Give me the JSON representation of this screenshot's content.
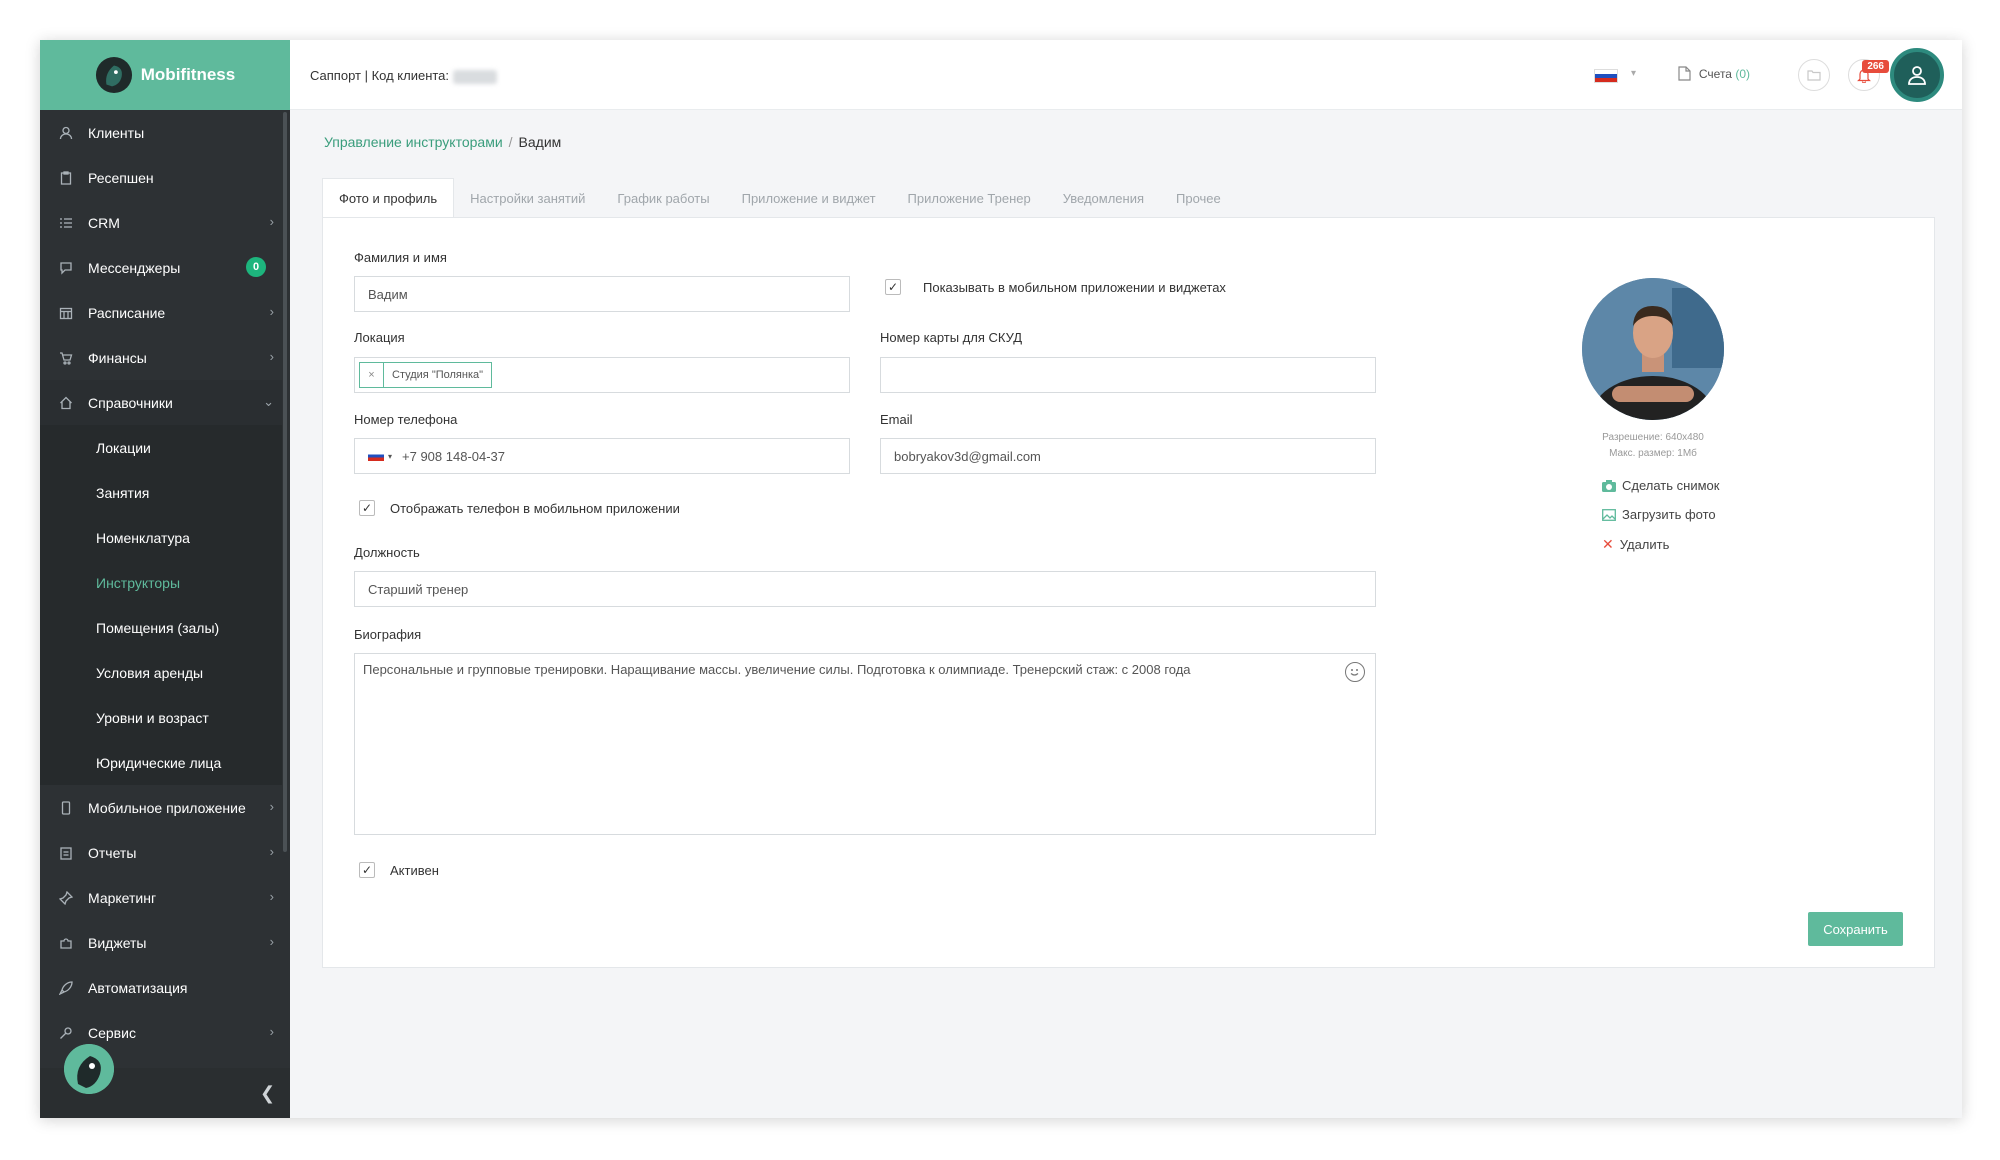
{
  "app": {
    "name": "Mobifitness"
  },
  "topbar": {
    "support_label": "Саппорт | Код клиента:",
    "invoices_label": "Счета",
    "invoices_count": "(0)",
    "notifications_count": "266"
  },
  "sidebar": {
    "items": [
      {
        "label": "Клиенты",
        "icon": "user-icon"
      },
      {
        "label": "Ресепшен",
        "icon": "clipboard-icon"
      },
      {
        "label": "CRM",
        "icon": "list-icon"
      },
      {
        "label": "Мессенджеры",
        "icon": "chat-icon",
        "badge": "0"
      },
      {
        "label": "Расписание",
        "icon": "calendar-icon"
      },
      {
        "label": "Финансы",
        "icon": "cart-icon"
      },
      {
        "label": "Справочники",
        "icon": "home-icon"
      }
    ],
    "sub_items": [
      {
        "label": "Локации"
      },
      {
        "label": "Занятия"
      },
      {
        "label": "Номенклатура"
      },
      {
        "label": "Инструкторы",
        "active": true
      },
      {
        "label": "Помещения (залы)"
      },
      {
        "label": "Условия аренды"
      },
      {
        "label": "Уровни и возраст"
      },
      {
        "label": "Юридические лица"
      }
    ],
    "items_after": [
      {
        "label": "Мобильное приложение",
        "icon": "mobile-icon"
      },
      {
        "label": "Отчеты",
        "icon": "report-icon"
      },
      {
        "label": "Маркетинг",
        "icon": "pin-icon"
      },
      {
        "label": "Виджеты",
        "icon": "puzzle-icon"
      },
      {
        "label": "Автоматизация",
        "icon": "rocket-icon"
      },
      {
        "label": "Сервис",
        "icon": "key-icon"
      }
    ]
  },
  "breadcrumb": {
    "parent": "Управление инструкторами",
    "separator": "/",
    "current": "Вадим"
  },
  "tabs": [
    "Фото и профиль",
    "Настройки занятий",
    "График работы",
    "Приложение и виджет",
    "Приложение Тренер",
    "Уведомления",
    "Прочее"
  ],
  "form": {
    "name_label": "Фамилия и имя",
    "name_value": "Вадим",
    "show_in_app_label": "Показывать в мобильном приложении и виджетах",
    "location_label": "Локация",
    "location_tag": "Студия \"Полянка\"",
    "card_label": "Номер карты для СКУД",
    "card_value": "",
    "phone_label": "Номер телефона",
    "phone_value": "+7 908 148-04-37",
    "email_label": "Email",
    "email_value": "bobryakov3d@gmail.com",
    "show_phone_label": "Отображать телефон в мобильном приложении",
    "position_label": "Должность",
    "position_value": "Старший тренер",
    "bio_label": "Биография",
    "bio_value": "Персональные и групповые тренировки. Наращивание массы. увеличение силы. Подготовка к олимпиаде. Тренерский стаж: с 2008 года",
    "active_label": "Активен",
    "save_label": "Сохранить"
  },
  "photo": {
    "resolution": "Разрешение: 640x480",
    "max_size": "Макс. размер: 1Мб",
    "take_photo": "Сделать снимок",
    "upload_photo": "Загрузить фото",
    "delete": "Удалить"
  },
  "colors": {
    "accent": "#5fba9c",
    "sidebar": "#2d3134",
    "danger": "#e74c3c"
  }
}
